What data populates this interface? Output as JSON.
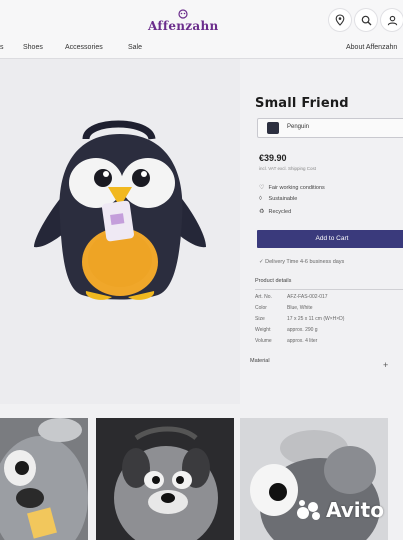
{
  "brand": {
    "name": "Affenzahn"
  },
  "header": {
    "icons": [
      "location-pin-icon",
      "search-icon",
      "account-icon"
    ]
  },
  "nav": {
    "items": [
      "s",
      "Shoes",
      "Accessories",
      "Sale"
    ],
    "right": "About Affenzahn"
  },
  "product": {
    "title": "Small Friend",
    "variant": "Penguin",
    "price": "€39.90",
    "vat": "incl. VAT  excl. Shipping Cost",
    "features": [
      {
        "icon": "heart-icon",
        "label": "Fair working conditions"
      },
      {
        "icon": "drop-icon",
        "label": "Sustainable"
      },
      {
        "icon": "recycle-icon",
        "label": "Recycled"
      }
    ],
    "add_to_cart": "Add to Cart",
    "delivery": "Delivery Time 4-6 business days",
    "details_heading": "Product details",
    "details": [
      {
        "key": "Art. No.",
        "value": "AFZ-FAS-002-017"
      },
      {
        "key": "Color",
        "value": "Blue, White"
      },
      {
        "key": "Size",
        "value": "17 x 25 x 11 cm (W×H×D)"
      },
      {
        "key": "Weight",
        "value": "approx. 290 g"
      },
      {
        "key": "Volume",
        "value": "approx. 4 liter"
      }
    ],
    "material_heading": "Material",
    "material_toggle": "+"
  },
  "watermark": {
    "text": "Avito"
  },
  "colors": {
    "brand_purple": "#6b2d8c",
    "button": "#3a3a7c",
    "penguin_body": "#2b2d3e",
    "penguin_belly": "#f0a72a",
    "beak": "#f1b81f"
  }
}
